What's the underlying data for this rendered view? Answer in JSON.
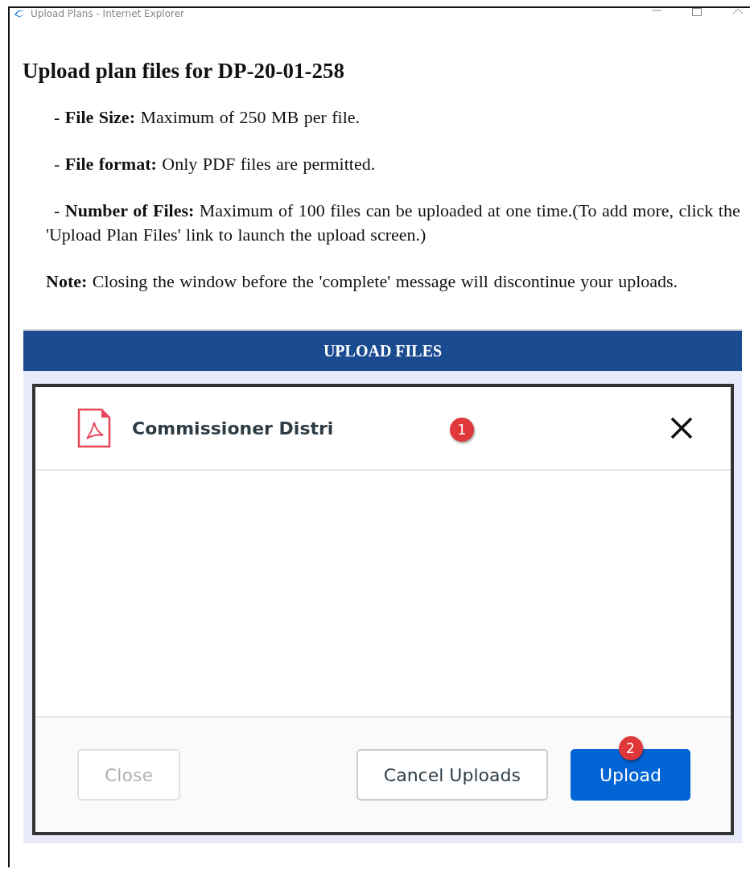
{
  "window": {
    "title": "Upload Plans - Internet Explorer"
  },
  "heading": "Upload plan files for DP-20-01-258",
  "notes": [
    "- **File Size:** Maximum of 250 MB per file.",
    "- **File format:** Only PDF files are permitted.",
    "- **Number of Files:** Maximum of 100 files can be uploaded at one time.(To add more, click the 'Upload Plan Files' link to launch the upload screen.)",
    "**Note:** Closing the window before the 'complete' message will discontinue your uploads."
  ],
  "panel": {
    "title": "UPLOAD FILES"
  },
  "files": [
    {
      "name": "Commissioner Distri",
      "marker": "1"
    }
  ],
  "buttons": [
    {
      "label": "Close",
      "kind": "secondary",
      "disabled": true
    },
    {
      "label": "Cancel Uploads",
      "kind": "secondary",
      "disabled": false
    },
    {
      "label": "Upload",
      "kind": "primary",
      "disabled": false,
      "marker": "2"
    }
  ]
}
